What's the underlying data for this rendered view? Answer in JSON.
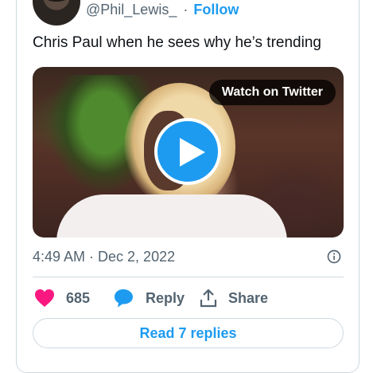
{
  "author": {
    "handle": "@Phil_Lewis_",
    "separator": "·",
    "follow_label": "Follow",
    "avatar_icon": "profile-avatar"
  },
  "tweet": {
    "text": "Chris Paul when he sees why he’s trending",
    "timestamp": "4:49 AM · Dec 2, 2022"
  },
  "media": {
    "watch_label": "Watch on Twitter",
    "play_icon": "play-icon"
  },
  "actions": {
    "likes_count": "685",
    "reply_label": "Reply",
    "share_label": "Share",
    "like_icon": "heart-icon",
    "reply_icon": "speech-bubble-icon",
    "share_icon": "share-upload-icon",
    "info_icon": "info-icon"
  },
  "footer": {
    "read_replies_label": "Read 7 replies"
  },
  "colors": {
    "accent": "#1d9bf0",
    "like": "#f91880",
    "muted": "#536471",
    "text": "#0f1419",
    "border": "#cfd9de"
  }
}
